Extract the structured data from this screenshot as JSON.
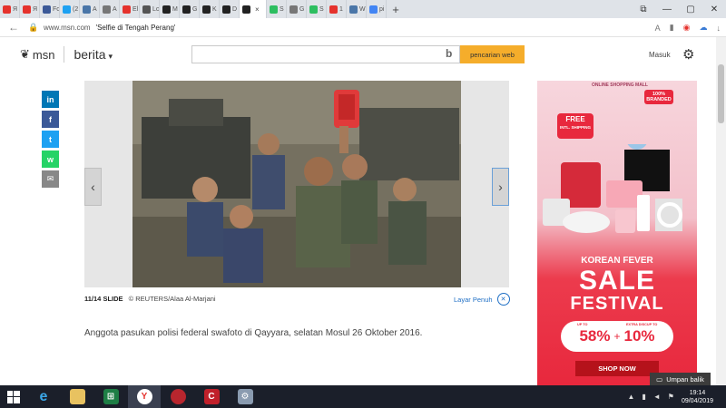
{
  "browser": {
    "tabs": [
      {
        "label": "Я",
        "color": "#e5322d"
      },
      {
        "label": "Я",
        "color": "#e5322d"
      },
      {
        "label": "Fo",
        "color": "#3b5998"
      },
      {
        "label": "(2",
        "color": "#1da1f2"
      },
      {
        "label": "А",
        "color": "#4a76a8"
      },
      {
        "label": "А",
        "color": "#777777"
      },
      {
        "label": "El",
        "color": "#e5322d"
      },
      {
        "label": "Lc",
        "color": "#555555"
      },
      {
        "label": "M",
        "color": "#222222"
      },
      {
        "label": "G",
        "color": "#222222"
      },
      {
        "label": "K",
        "color": "#222222"
      },
      {
        "label": "D",
        "color": "#222222"
      },
      {
        "label": "",
        "color": "#222222",
        "active": true
      },
      {
        "label": "S",
        "color": "#2dbe60"
      },
      {
        "label": "G",
        "color": "#777777"
      },
      {
        "label": "S",
        "color": "#2dbe60"
      },
      {
        "label": "1",
        "color": "#e5322d"
      },
      {
        "label": "W",
        "color": "#4a76a8"
      },
      {
        "label": "pi",
        "color": "#4285f4"
      }
    ],
    "new_tab": "+",
    "close_tab": "×",
    "url": "www.msn.com",
    "page_title": "'Selfie di Tengah Perang'"
  },
  "header": {
    "logo": "msn",
    "section": "berita",
    "search_placeholder": "",
    "search_button": "pencarian web",
    "signin": "Masuk"
  },
  "slide": {
    "counter": "11/14 SLIDE",
    "credit": "© REUTERS/Alaa Al-Marjani",
    "fullscreen": "Layar Penuh",
    "caption": "Anggota pasukan polisi federal swafoto di Qayyara, selatan Mosul 26 Oktober 2016."
  },
  "social": [
    {
      "icon": "linkedin-icon",
      "glyph": "in",
      "color": "#0077b5"
    },
    {
      "icon": "facebook-icon",
      "glyph": "f",
      "color": "#3b5998"
    },
    {
      "icon": "twitter-icon",
      "glyph": "t",
      "color": "#1da1f2"
    },
    {
      "icon": "whatsapp-icon",
      "glyph": "w",
      "color": "#25d366"
    },
    {
      "icon": "email-icon",
      "glyph": "✉",
      "color": "#888888"
    }
  ],
  "ad": {
    "brand": "ONLINE SHOPPING MALL",
    "badge_line1": "100%",
    "badge_line2": "BRANDED",
    "free_line1": "FREE",
    "free_line2": "INTL. SHIPPING",
    "title1": "KOREAN FEVER",
    "title2": "SALE",
    "title3": "FESTIVAL",
    "sub_left": "UP TO",
    "sub_right": "EXTRA DISCUP TO",
    "pct1": "58%",
    "plus": "+",
    "pct2": "10%",
    "cta": "SHOP NOW"
  },
  "feedback": "Umpan balik",
  "taskbar": {
    "time": "19:14",
    "date": "09/04/2019"
  }
}
